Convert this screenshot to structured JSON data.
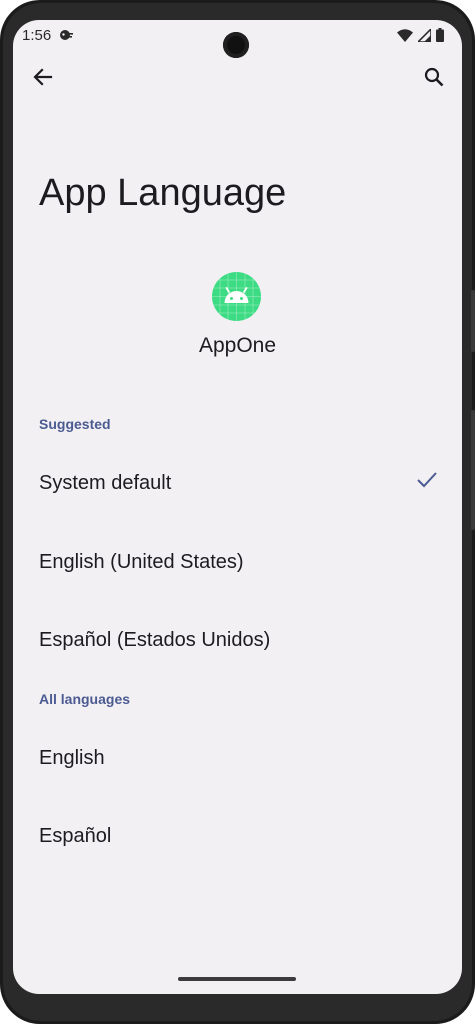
{
  "status": {
    "time": "1:56"
  },
  "header": {
    "title": "App Language"
  },
  "app": {
    "name": "AppOne"
  },
  "sections": {
    "suggested": "Suggested",
    "all": "All languages"
  },
  "suggested_languages": [
    {
      "label": "System default",
      "selected": true
    },
    {
      "label": "English (United States)",
      "selected": false
    },
    {
      "label": "Español (Estados Unidos)",
      "selected": false
    }
  ],
  "all_languages": [
    {
      "label": "English"
    },
    {
      "label": "Español"
    }
  ],
  "colors": {
    "background": "#f3f0f4",
    "accent": "#4b5b92",
    "app_icon": "#3ddc84",
    "text": "#1c1b1f"
  },
  "icons": {
    "back": "arrow-back-icon",
    "search": "search-icon",
    "check": "check-icon",
    "wifi": "wifi-icon",
    "signal": "signal-icon",
    "battery": "battery-icon"
  }
}
